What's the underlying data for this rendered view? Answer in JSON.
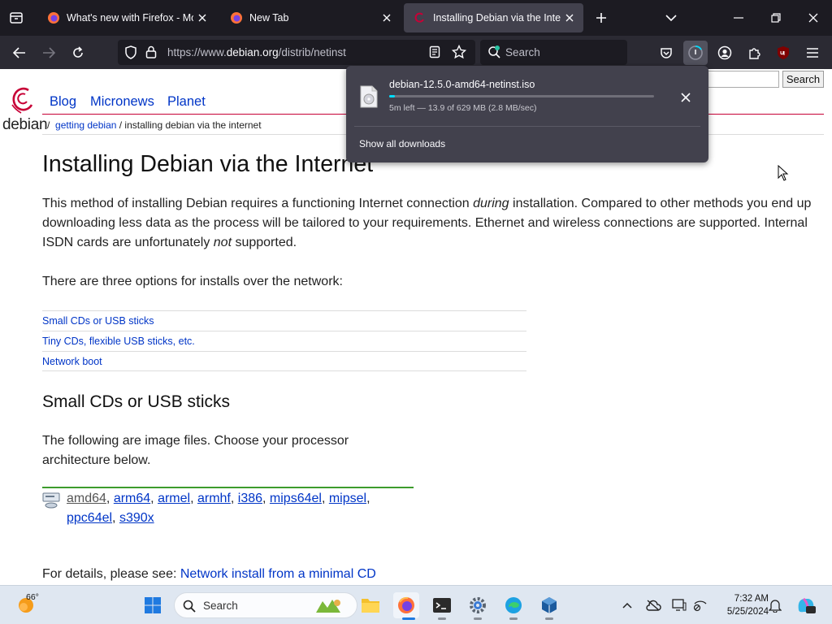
{
  "tabs": [
    {
      "title": "What's new with Firefox - More",
      "active": false
    },
    {
      "title": "New Tab",
      "active": false
    },
    {
      "title": "Installing Debian via the Internet",
      "active": true
    }
  ],
  "url": {
    "prefix": "https://www.",
    "domain": "debian.org",
    "path": "/distrib/netinst"
  },
  "search_placeholder": "Search",
  "page": {
    "logo_text": "debian",
    "nav": [
      "Blog",
      "Micronews",
      "Planet"
    ],
    "search_button": "Search",
    "breadcrumb": {
      "sep": "/",
      "link": "getting debian",
      "current": "/ installing debian via the internet"
    },
    "title": "Installing Debian via the Internet",
    "intro": {
      "p1": "This method of installing Debian requires a functioning Internet connection ",
      "em1": "during",
      "p2": " installation. Compared to other methods you end up downloading less data as the process will be tailored to your requirements. Ethernet and wireless connections are supported. Internal ISDN cards are unfortunately ",
      "em2": "not",
      "p3": " supported."
    },
    "options_text": "There are three options for installs over the network:",
    "toc": [
      "Small CDs or USB sticks",
      "Tiny CDs, flexible USB sticks, etc.",
      "Network boot"
    ],
    "section_title": "Small CDs or USB sticks",
    "section_text": "The following are image files. Choose your processor architecture below.",
    "arches": [
      "amd64",
      "arm64",
      "armel",
      "armhf",
      "i386",
      "mips64el",
      "mipsel",
      "ppc64el",
      "s390x"
    ],
    "details_label": "For details, please see: ",
    "details_link": "Network install from a minimal CD"
  },
  "download": {
    "filename": "debian-12.5.0-amd64-netinst.iso",
    "status": "5m left — 13.9 of 629 MB (2.8 MB/sec)",
    "progress": 0.022,
    "show_all": "Show all downloads"
  },
  "taskbar": {
    "weather": "66°",
    "search": "Search",
    "time": "7:32 AM",
    "date": "5/25/2024"
  },
  "colors": {
    "accent": "#00ddff",
    "link": "#0035c7",
    "debian_red": "#c70036"
  }
}
